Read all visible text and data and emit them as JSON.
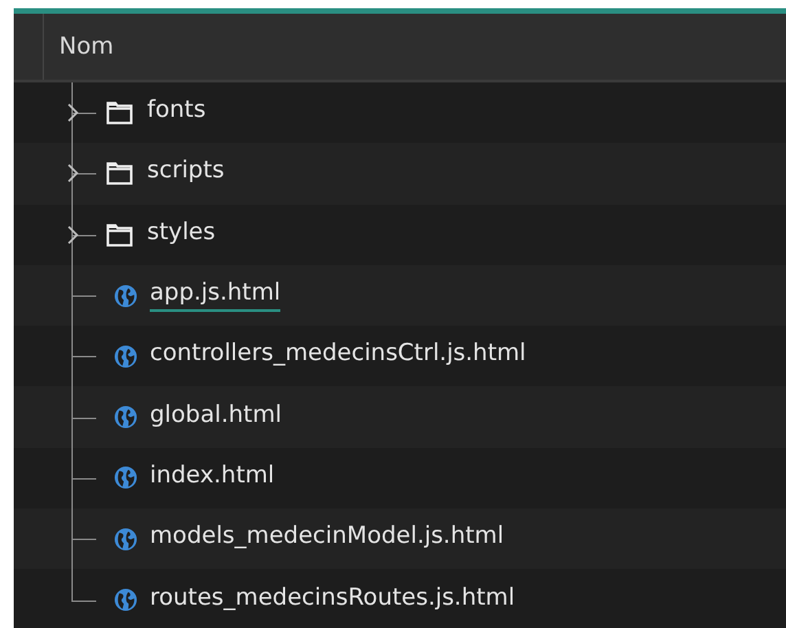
{
  "table": {
    "columns": [
      "Nom"
    ],
    "rows": [
      {
        "kind": "folder",
        "name": "fonts",
        "expanded": false,
        "selected": false
      },
      {
        "kind": "folder",
        "name": "scripts",
        "expanded": false,
        "selected": false
      },
      {
        "kind": "folder",
        "name": "styles",
        "expanded": false,
        "selected": false
      },
      {
        "kind": "file",
        "name": "app.js.html",
        "selected": true
      },
      {
        "kind": "file",
        "name": "controllers_medecinsCtrl.js.html",
        "selected": false
      },
      {
        "kind": "file",
        "name": "global.html",
        "selected": false
      },
      {
        "kind": "file",
        "name": "index.html",
        "selected": false
      },
      {
        "kind": "file",
        "name": "models_medecinModel.js.html",
        "selected": false
      },
      {
        "kind": "file",
        "name": "routes_medecinsRoutes.js.html",
        "selected": false
      }
    ]
  }
}
